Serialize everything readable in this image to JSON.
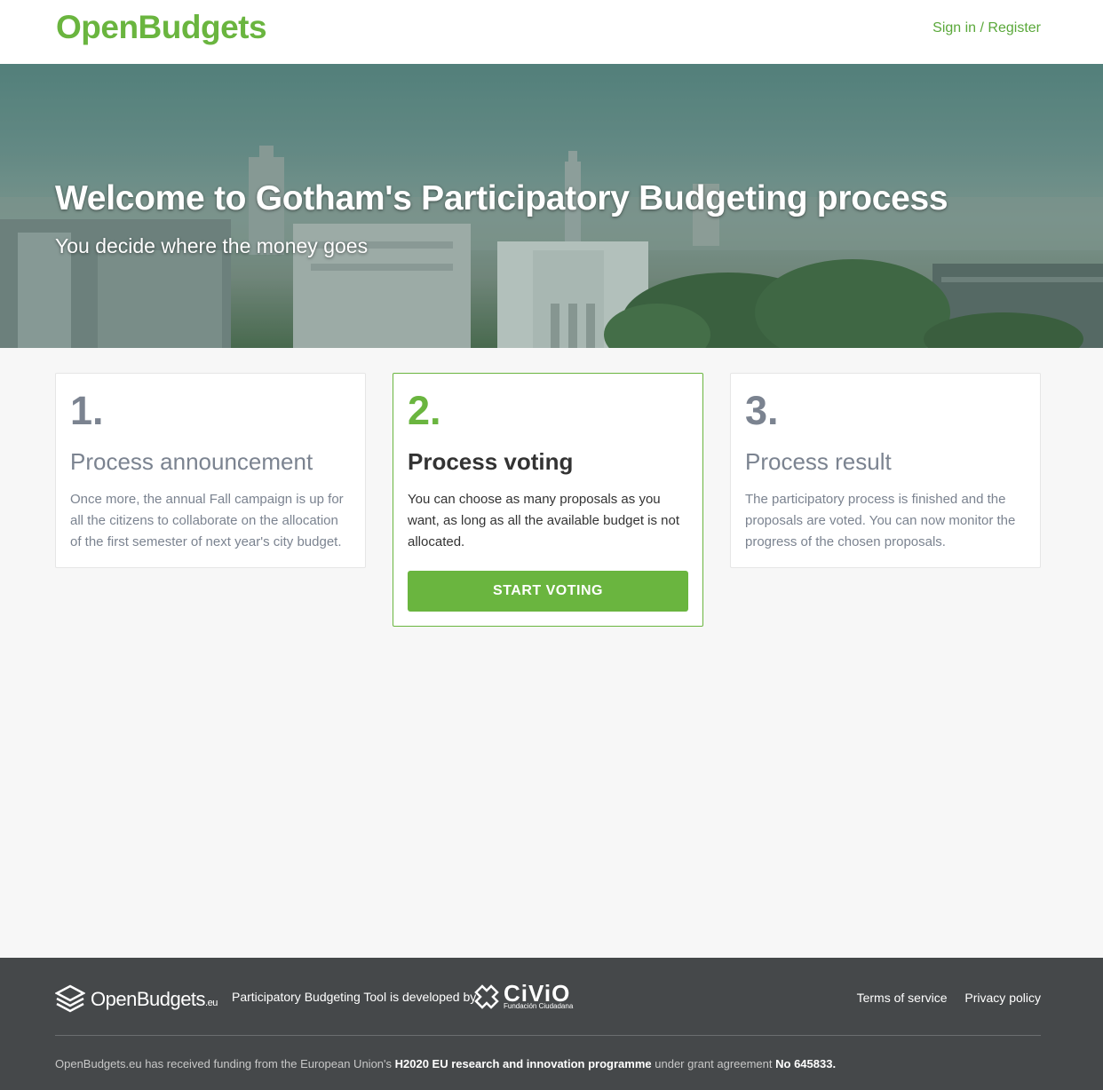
{
  "header": {
    "brand": "OpenBudgets",
    "signin": "Sign in / Register"
  },
  "hero": {
    "title": "Welcome to Gotham's Participatory Budgeting process",
    "subtitle": "You decide where the money goes"
  },
  "steps": [
    {
      "number": "1.",
      "title": "Process announcement",
      "description": "Once more, the annual Fall campaign is up for all the citizens to collaborate on the allocation of the first semester of next year's city budget."
    },
    {
      "number": "2.",
      "title": "Process voting",
      "description": "You can choose as many proposals as you want, as long as all the available budget is not allocated.",
      "button": "START VOTING"
    },
    {
      "number": "3.",
      "title": "Process result",
      "description": "The participatory process is finished and the proposals are voted. You can now monitor the progress of the chosen proposals."
    }
  ],
  "footer": {
    "logo_main": "OpenBudgets",
    "logo_suffix": ".eu",
    "developed_by": "Participatory Budgeting Tool is developed by",
    "civio_name": "CiViO",
    "civio_sub": "Fundación Ciudadana",
    "terms": "Terms of service",
    "privacy": "Privacy policy",
    "funding_pre": "OpenBudgets.eu has received funding from the European Union's",
    "funding_programme": "H2020 EU research and innovation programme",
    "funding_mid": "under grant agreement",
    "funding_no": "No 645833."
  },
  "colors": {
    "accent": "#6ab53f",
    "footer_bg": "#45484a",
    "page_bg": "#f7f7f7",
    "muted": "#7b8390"
  }
}
